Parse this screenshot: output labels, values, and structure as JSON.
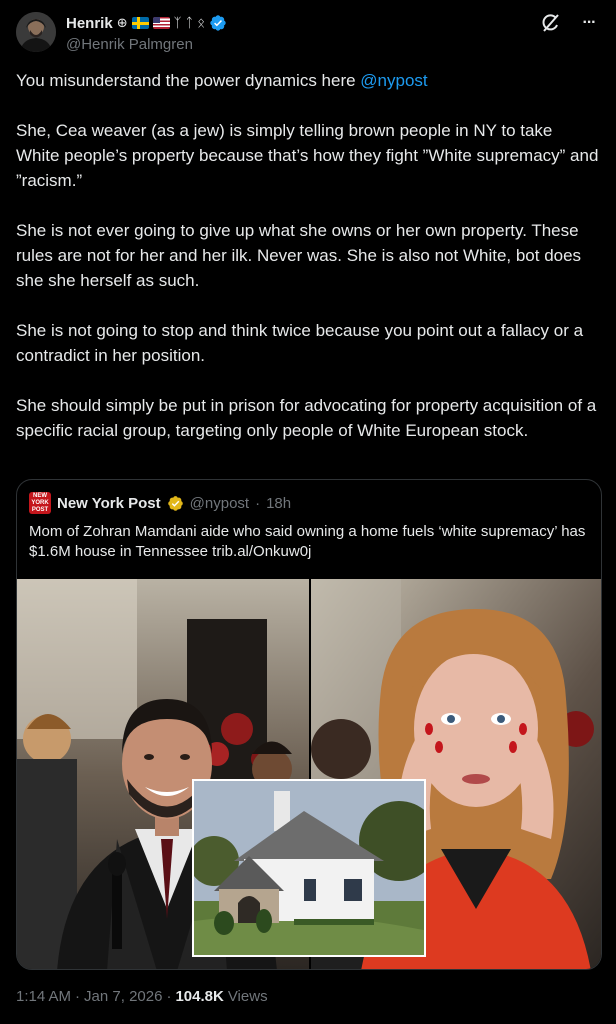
{
  "author": {
    "display_name": "Henrik",
    "handle": "@Henrik Palmgren",
    "name_symbols": [
      "⊕",
      "ᛉ",
      "ᛏ",
      "ᛟ"
    ],
    "flags": [
      "sweden-flag",
      "usa-flag"
    ],
    "verified_icon": "verified-badge-icon",
    "avatar_icon": "user-avatar"
  },
  "header_actions": {
    "grok_icon": "grok-icon",
    "more_label": "···"
  },
  "tweet": {
    "intro": "You misunderstand the power dynamics here ",
    "mention": "@nypost",
    "paragraphs": [
      "She, Cea weaver (as a jew) is simply telling brown people in NY to take White people’s property because that’s how they fight ”White supremacy” and ”racism.”",
      "She is not ever going to give up what she owns or her own property. These rules are not for her and her ilk. Never was. She is also not White, bot does she she herself as such.",
      "She is not going to stop and think twice because you point out a fallacy or a contradict in her position.",
      "She should simply be put in prison for advocating for property acquisition of a specific racial group, targeting only people of White European stock."
    ]
  },
  "quoted_tweet": {
    "name": "New York Post",
    "handle": "@nypost",
    "separator": "·",
    "time": "18h",
    "avatar_text": "NEW YORK POST",
    "text": "Mom of Zohran Mamdani aide who said owning a home fuels ‘white supremacy’ has $1.6M house in Tennessee trib.al/Onkuw0j",
    "media": [
      "man-smiling-photo",
      "woman-hands-on-face-photo",
      "white-house-inset-photo"
    ]
  },
  "footer": {
    "time": "1:14 AM",
    "separator": "·",
    "date": "Jan 7, 2026",
    "separator2": "·",
    "views_count": "104.8K",
    "views_label": "Views"
  },
  "colors": {
    "background": "#000000",
    "text": "#e7e9ea",
    "muted": "#71767b",
    "link": "#1d9bf0",
    "border": "#2f3336",
    "verified_blue": "#1d9bf0",
    "verified_gold": "#e2b719"
  }
}
